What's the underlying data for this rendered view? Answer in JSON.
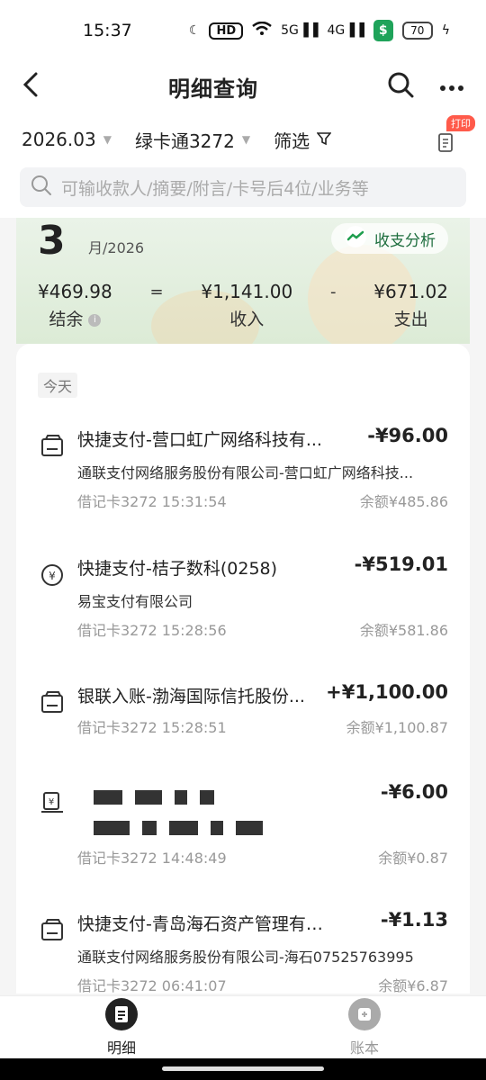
{
  "status": {
    "time": "15:37",
    "hd_label": "HD",
    "net1": "5G",
    "net2": "4G",
    "battery": "70",
    "shield_glyph": "$"
  },
  "nav": {
    "title": "明细查询"
  },
  "filters": {
    "month": "2026.03",
    "card": "绿卡通3272",
    "screen": "筛选",
    "print_badge": "打印"
  },
  "search": {
    "placeholder": "可输收款人/摘要/附言/卡号后4位/业务等"
  },
  "summary": {
    "month_num": "3",
    "month_suffix": "月/2026",
    "analysis_label": "收支分析",
    "balance_amount": "¥469.98",
    "balance_label": "结余",
    "eq": "=",
    "income_amount": "¥1,141.00",
    "income_label": "收入",
    "minus": "-",
    "expense_amount": "¥671.02",
    "expense_label": "支出"
  },
  "list": {
    "section_label": "今天",
    "transactions": [
      {
        "name": "快捷支付-营口虹广网络科技有...",
        "amount": "-¥96.00",
        "sub": "通联支付网络服务股份有限公司-营口虹广网络科技...",
        "meta": "借记卡3272 15:31:54",
        "balance": "余额¥485.86"
      },
      {
        "name": "快捷支付-桔子数科(0258)",
        "amount": "-¥519.01",
        "sub": "易宝支付有限公司",
        "meta": "借记卡3272 15:28:56",
        "balance": "余额¥581.86"
      },
      {
        "name": "银联入账-渤海国际信托股份...",
        "amount": "+¥1,100.00",
        "sub": "",
        "meta": "借记卡3272 15:28:51",
        "balance": "余额¥1,100.87"
      },
      {
        "name": "",
        "amount": "-¥6.00",
        "sub": "",
        "meta": "借记卡3272 14:48:49",
        "balance": "余额¥0.87"
      },
      {
        "name": "快捷支付-青岛海石资产管理有限...",
        "amount": "-¥1.13",
        "sub": "通联支付网络服务股份有限公司-海石07525763995",
        "meta": "借记卡3272 06:41:07",
        "balance": "余额¥6.87"
      }
    ]
  },
  "tabs": {
    "detail": "明细",
    "ledger": "账本"
  },
  "colors": {
    "accent_green": "#1e6e3e",
    "badge_red": "#ff5a4a"
  }
}
